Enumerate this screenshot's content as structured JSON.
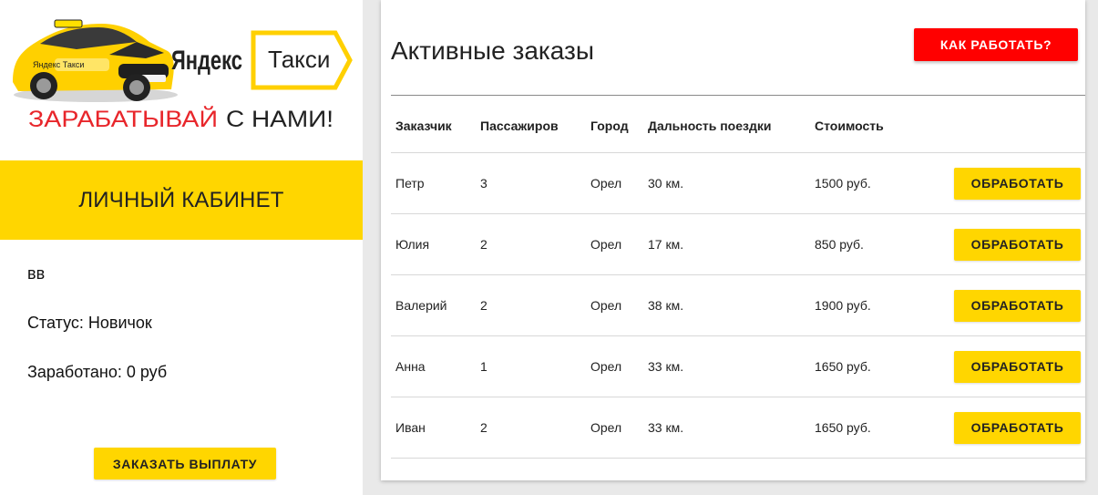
{
  "sidebar": {
    "logo": {
      "brand_word": "Яндекс",
      "service_word": "Такси",
      "car_brand_text": "Яндекс Такси",
      "slogan_part1": "ЗАРАБАТЫВАЙ",
      "slogan_part2": "С НАМИ!"
    },
    "cabinet_title": "ЛИЧНЫЙ КАБИНЕТ",
    "user_name": "вв",
    "status_text": "Статус: Новичок",
    "earned_text": "Заработано: 0 руб",
    "payout_button": "ЗАКАЗАТЬ ВЫПЛАТУ"
  },
  "main": {
    "title": "Активные заказы",
    "how_button": "КАК РАБОТАТЬ?",
    "columns": [
      "Заказчик",
      "Пассажиров",
      "Город",
      "Дальность поездки",
      "Стоимость"
    ],
    "action_label": "ОБРАБОТАТЬ",
    "orders": [
      {
        "customer": "Петр",
        "passengers": "3",
        "city": "Орел",
        "distance": "30 км.",
        "price": "1500 руб."
      },
      {
        "customer": "Юлия",
        "passengers": "2",
        "city": "Орел",
        "distance": "17 км.",
        "price": "850 руб."
      },
      {
        "customer": "Валерий",
        "passengers": "2",
        "city": "Орел",
        "distance": "38 км.",
        "price": "1900 руб."
      },
      {
        "customer": "Анна",
        "passengers": "1",
        "city": "Орел",
        "distance": "33 км.",
        "price": "1650 руб."
      },
      {
        "customer": "Иван",
        "passengers": "2",
        "city": "Орел",
        "distance": "33 км.",
        "price": "1650 руб."
      }
    ]
  },
  "colors": {
    "yellow": "#ffd600",
    "red": "#ff0000",
    "slogan_red": "#e8262b",
    "logo_red": "#e30613"
  }
}
